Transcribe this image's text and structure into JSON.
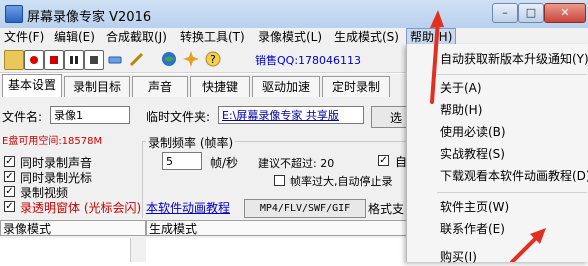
{
  "window": {
    "title": "屏幕录像专家 V2016",
    "controls": {
      "minimize": "–",
      "maximize": "□",
      "close": "✕"
    }
  },
  "menubar": {
    "items": [
      {
        "label": "文件(F)"
      },
      {
        "label": "编辑(E)"
      },
      {
        "label": "合成截取(J)"
      },
      {
        "label": "转换工具(T)"
      },
      {
        "label": "录像模式(L)"
      },
      {
        "label": "生成模式(S)"
      },
      {
        "label": "帮助(H)"
      }
    ]
  },
  "toolbar": {
    "sales_qq": "销售QQ:178046113",
    "icons": [
      "folder-icon",
      "record-icon",
      "stop-icon",
      "pause-icon",
      "square-icon",
      "eraser-icon",
      "pen-icon",
      "globe-icon",
      "sparkle-icon",
      "question-icon"
    ]
  },
  "tabs": [
    "基本设置",
    "录制目标",
    "声音",
    "快捷键",
    "驱动加速",
    "定时录制"
  ],
  "settings": {
    "filename_label": "文件名:",
    "filename_value": "录像1",
    "tempfolder_label": "临时文件夹:",
    "tempfolder_value": "E:\\屏幕录像专家 共享版",
    "browse_label": "选",
    "disk_space": "E盘可用空间:18578M",
    "frame_rate_group": "录制频率 (帧率)",
    "frame_rate_value": "5",
    "frame_rate_unit": "帧/秒",
    "suggest_label": "建议不超过: 20",
    "autostop_partial": "自",
    "autostop_frame_label": "帧率过大,自动停止录",
    "checkboxes": [
      {
        "label": "同时录制声音",
        "checked": true,
        "color": "#000000"
      },
      {
        "label": "同时录制光标",
        "checked": true,
        "color": "#000000"
      },
      {
        "label": "录制视频",
        "checked": true,
        "color": "#000000"
      },
      {
        "label": "录透明窗体 (光标会闪)",
        "checked": true,
        "color": "#cc0000"
      }
    ],
    "tutorial_link": "本软件动画教程",
    "format_box": "MP4/FLV/SWF/GIF",
    "format_suffix": "格式支"
  },
  "subtabs": [
    "录像模式",
    "生成模式"
  ],
  "help_menu": {
    "items": [
      "自动获取新版本升级通知(Y)",
      "关于(A)",
      "帮助(H)",
      "使用必读(B)",
      "实战教程(S)",
      "下载观看本软件动画教程(D)",
      "软件主页(W)",
      "联系作者(E)",
      "购买(I)"
    ]
  },
  "colors": {
    "accent": "#cc0000",
    "link": "#0000cc",
    "annotation_arrow": "#e03020"
  }
}
